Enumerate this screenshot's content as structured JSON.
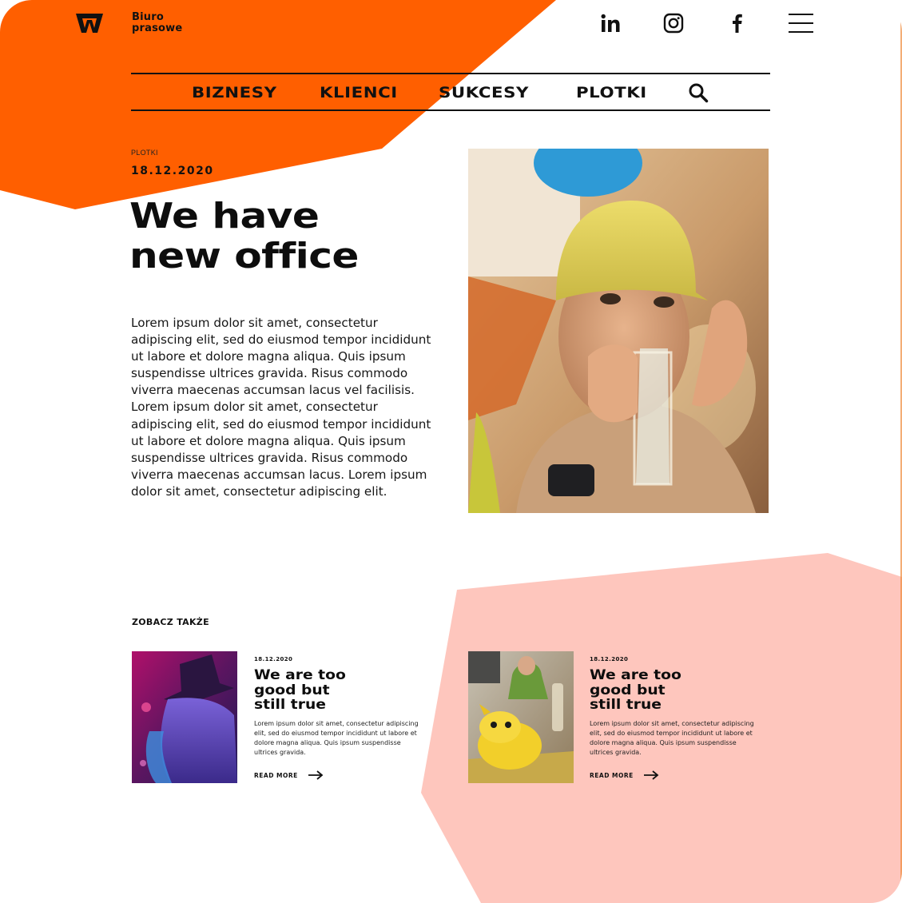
{
  "brand": {
    "name": "Biuro\nprasowe",
    "accent_color": "#ff5f00",
    "pink_color": "#fec6bd"
  },
  "social": {
    "linkedin": "linkedin-icon",
    "instagram": "instagram-icon",
    "facebook": "facebook-icon",
    "menu": "hamburger-menu-icon"
  },
  "nav": {
    "items": [
      {
        "label": "BIZNESY"
      },
      {
        "label": "KLIENCI"
      },
      {
        "label": "SUKCESY"
      },
      {
        "label": "PLOTKI"
      }
    ],
    "search_icon": "search-icon"
  },
  "article": {
    "category": "PLOTKI",
    "date": "18.12.2020",
    "title": "We have\nnew office",
    "body": "Lorem ipsum dolor sit amet, consectetur adipiscing elit, sed do eiusmod tempor incididunt ut labore et dolore magna aliqua. Quis ipsum suspendisse ultrices gravida. Risus commodo viverra maecenas accumsan lacus vel facilisis. Lorem ipsum dolor sit amet, consectetur adipiscing elit, sed do eiusmod tempor incididunt ut labore et dolore magna aliqua. Quis ipsum suspendisse ultrices gravida. Risus commodo viverra maecenas accumsan lacus. Lorem ipsum dolor sit amet, consectetur adipiscing elit."
  },
  "related": {
    "heading": "ZOBACZ TAKŻE",
    "cards": [
      {
        "date": "18.12.2020",
        "title": "We are too\ngood but\nstill true",
        "text": "Lorem ipsum dolor sit amet, consectetur adipiscing elit, sed do eiusmod tempor incididunt ut labore et dolore magna aliqua. Quis ipsum suspendisse ultrices gravida.",
        "read_more": "READ MORE"
      },
      {
        "date": "18.12.2020",
        "title": "We are too\ngood but\nstill true",
        "text": "Lorem ipsum dolor sit amet, consectetur adipiscing elit, sed do eiusmod tempor incididunt ut labore et dolore magna aliqua. Quis ipsum suspendisse ultrices gravida.",
        "read_more": "READ MORE"
      }
    ]
  }
}
